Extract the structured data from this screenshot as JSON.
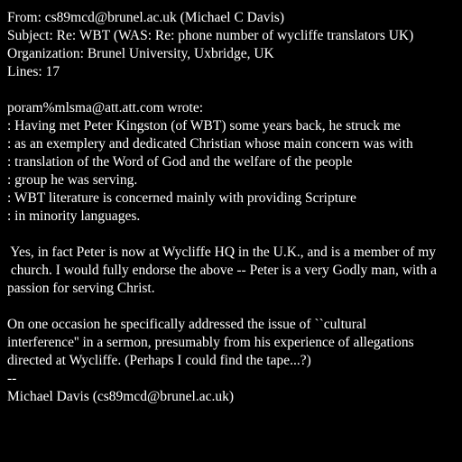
{
  "header": {
    "from": "From: cs89mcd@brunel.ac.uk (Michael C Davis)",
    "subject": "Subject: Re: WBT (WAS: Re: phone number of wycliffe translators UK)",
    "organization": "Organization: Brunel University, Uxbridge, UK",
    "lines": "Lines: 17"
  },
  "body": {
    "attribution": "poram%mlsma@att.att.com wrote:",
    "quoted": [
      ": Having met Peter Kingston (of WBT) some years back, he struck me",
      ": as an exemplery and dedicated Christian whose main concern was with",
      ": translation of the Word of God and the welfare of the people",
      ": group he was serving.",
      ": WBT literature is concerned mainly with providing Scripture",
      ": in minority languages."
    ],
    "paragraph1": [
      " Yes, in fact Peter is now at Wycliffe HQ in the U.K., and is a member of my",
      " church. I would fully endorse the above -- Peter is a very Godly man, with a",
      "passion for serving Christ."
    ],
    "paragraph2": [
      "On one occasion he specifically addressed the issue of ``cultural",
      "interference'' in a sermon, presumably from his experience of allegations",
      "directed at Wycliffe. (Perhaps I could find the tape...?)"
    ],
    "sig_separator": "--",
    "signature": "Michael Davis (cs89mcd@brunel.ac.uk)"
  }
}
